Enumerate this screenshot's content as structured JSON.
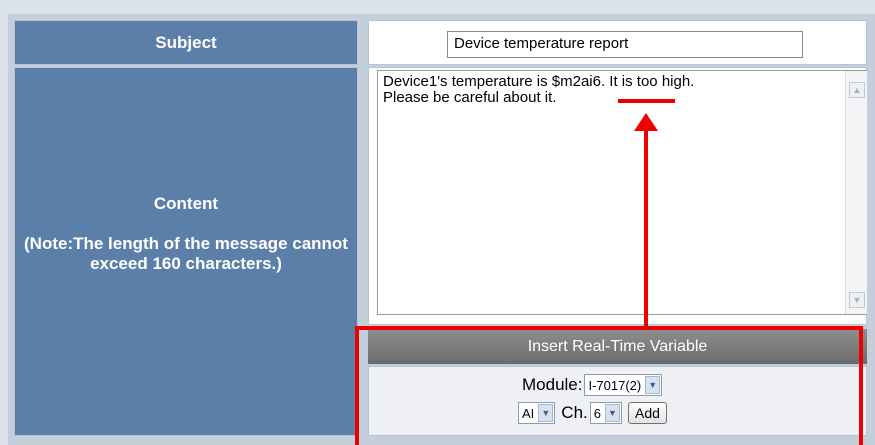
{
  "form": {
    "subject_label": "Subject",
    "subject_value": "Device temperature report",
    "content_label": "Content",
    "content_note": "(Note:The length of the message cannot exceed 160 characters.)",
    "content_value": "Device1's temperature is $m2ai6. It is too high.\nPlease be careful about it."
  },
  "insert_panel": {
    "header": "Insert Real-Time Variable",
    "module_label": "Module:",
    "module_value": "I-7017(2)",
    "type_value": "AI",
    "channel_label": "Ch.",
    "channel_value": "6",
    "add_label": "Add"
  },
  "icons": {
    "scroll_up": "chevron-up-icon",
    "scroll_down": "chevron-down-icon",
    "dropdown": "chevron-down-icon"
  },
  "colors": {
    "label_background": "#5b7fa8",
    "annotation": "#ee0000",
    "panel_header": "#7c7c7c"
  }
}
